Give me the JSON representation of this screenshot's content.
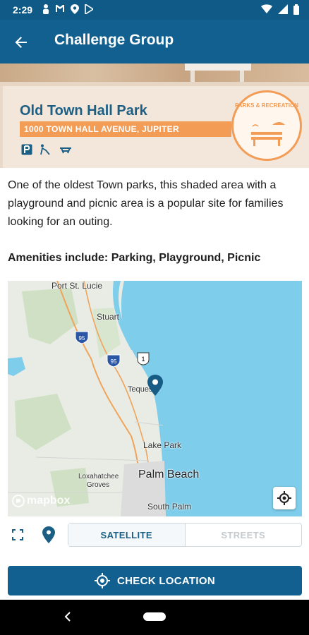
{
  "status_bar": {
    "time": "2:29"
  },
  "app_bar": {
    "title": "Challenge Group"
  },
  "park": {
    "name": "Old Town Hall Park",
    "address": "1000 TOWN HALL AVENUE, JUPITER",
    "badge_text": "PARKS & RECREATION",
    "amenity_icons": [
      "parking-icon",
      "playground-icon",
      "picnic-icon"
    ]
  },
  "description": "One of the oldest Town parks, this shaded area with a playground and picnic area is a popular site for families looking for an outing.",
  "amenities": "Amenities include: Parking, Playground, Picnic",
  "map": {
    "labels": [
      "Port St. Lucie",
      "Stuart",
      "Tequesta",
      "Lake Park",
      "Palm Beach",
      "Loxahatchee Groves",
      "South Palm"
    ],
    "shields": [
      "95",
      "95",
      "1"
    ],
    "attribution": "mapbox"
  },
  "map_controls": {
    "satellite_label": "SATELLITE",
    "streets_label": "STREETS"
  },
  "check_location": {
    "label": "CHECK LOCATION"
  },
  "colors": {
    "primary": "#12608f",
    "accent": "#f29c56",
    "water": "#7ecdeb",
    "land": "#e9ece4"
  }
}
